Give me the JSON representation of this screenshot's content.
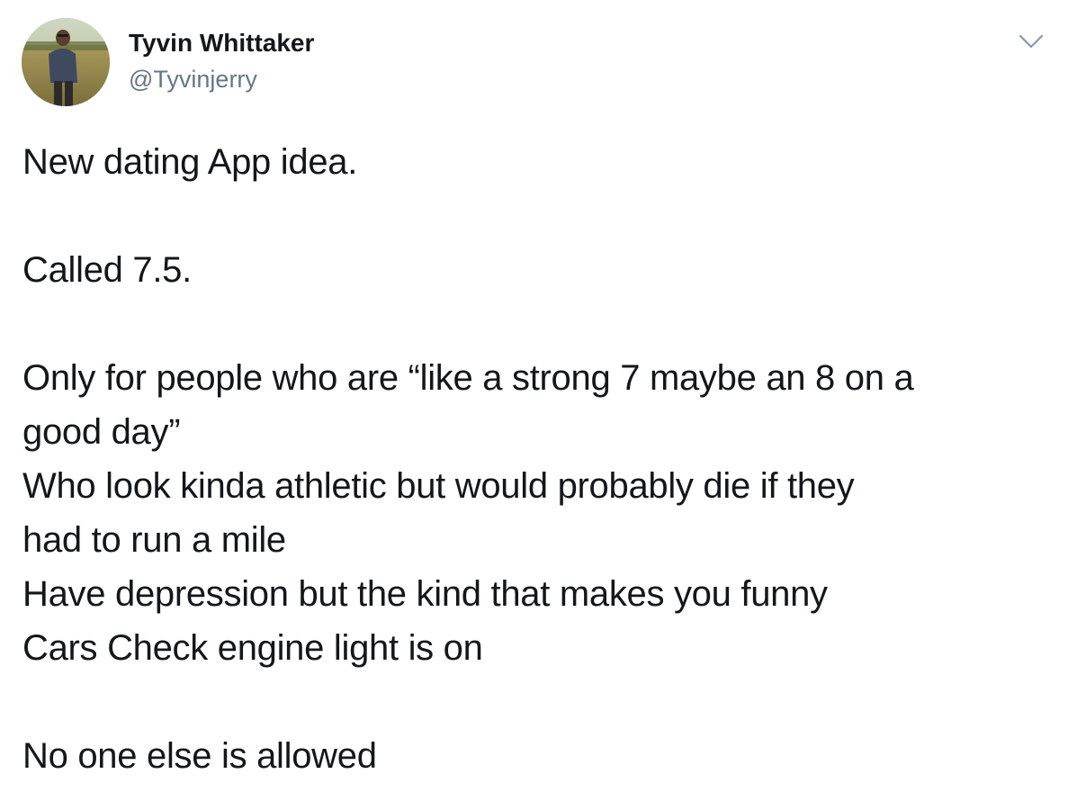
{
  "user": {
    "display_name": "Tyvin Whittaker",
    "handle": "@Tyvinjerry",
    "avatar_icon": "user-avatar-photo"
  },
  "menu": {
    "caret_icon": "chevron-down-icon"
  },
  "tweet": {
    "lines": [
      "New dating App idea.",
      "",
      "Called 7.5.",
      "",
      "Only for people who are “like a strong 7 maybe an 8 on a",
      "good day”",
      "Who look kinda athletic but would probably die if they",
      "had to run a mile",
      "Have depression but the kind that makes you funny",
      "Cars Check engine light is on",
      "",
      "No one else is allowed"
    ]
  },
  "colors": {
    "text": "#14171a",
    "secondary_text": "#657786",
    "caret": "#8899a6"
  }
}
